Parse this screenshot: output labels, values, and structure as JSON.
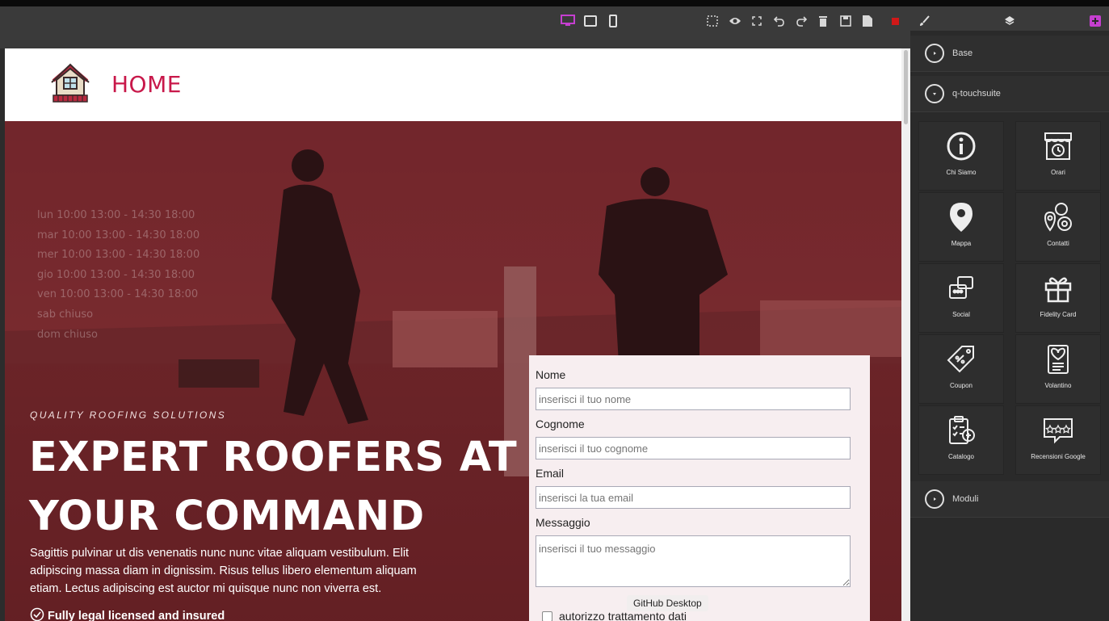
{
  "site": {
    "title": "HOME",
    "hours": [
      "lun 10:00  13:00 - 14:30  18:00",
      "mar 10:00  13:00 - 14:30  18:00",
      "mer 10:00  13:00 - 14:30  18:00",
      "gio 10:00  13:00 - 14:30  18:00",
      "ven 10:00  13:00 - 14:30  18:00",
      "sab chiuso",
      "dom chiuso"
    ],
    "tagline": "QUALITY ROOFING SOLUTIONS",
    "headline": "EXPERT ROOFERS AT YOUR COMMAND",
    "description": "Sagittis pulvinar ut dis venenatis nunc nunc vitae aliquam vestibulum. Elit adipiscing massa diam in dignissim. Risus tellus libero elementum aliquam etiam. Lectus adipiscing est auctor mi quisque nunc non viverra est.",
    "feature": "Fully legal licensed and insured"
  },
  "form": {
    "nome_label": "Nome",
    "nome_placeholder": "inserisci il tuo nome",
    "cognome_label": "Cognome",
    "cognome_placeholder": "inserisci il tuo cognome",
    "email_label": "Email",
    "email_placeholder": "inserisci la tua email",
    "messaggio_label": "Messaggio",
    "messaggio_placeholder": "inserisci il tuo messaggio",
    "consent": "autorizzo trattamento dati"
  },
  "tooltip": "GitHub Desktop",
  "sidebar": {
    "sections": {
      "base": "Base",
      "touchsuite": "q-touchsuite",
      "moduli": "Moduli"
    },
    "blocks": [
      "Chi Siamo",
      "Orari",
      "Mappa",
      "Contatti",
      "Social",
      "Fidelity Card",
      "Coupon",
      "Volantino",
      "Catalogo",
      "Recensioni Google"
    ]
  },
  "toolbar": {
    "device_icons": [
      "desktop-icon",
      "tablet-icon",
      "mobile-icon"
    ],
    "action_icons": [
      "select-icon",
      "preview-icon",
      "fullscreen-icon",
      "undo-icon",
      "redo-icon",
      "delete-icon",
      "save-icon",
      "export-icon",
      "stop-icon"
    ],
    "panel_icons": [
      "style-brush-icon",
      "layers-icon",
      "add-block-icon"
    ]
  },
  "colors": {
    "brand": "#c8184a",
    "active_device": "#c53fd0",
    "add_block": "#c53fd0",
    "stop": "#d01818"
  }
}
